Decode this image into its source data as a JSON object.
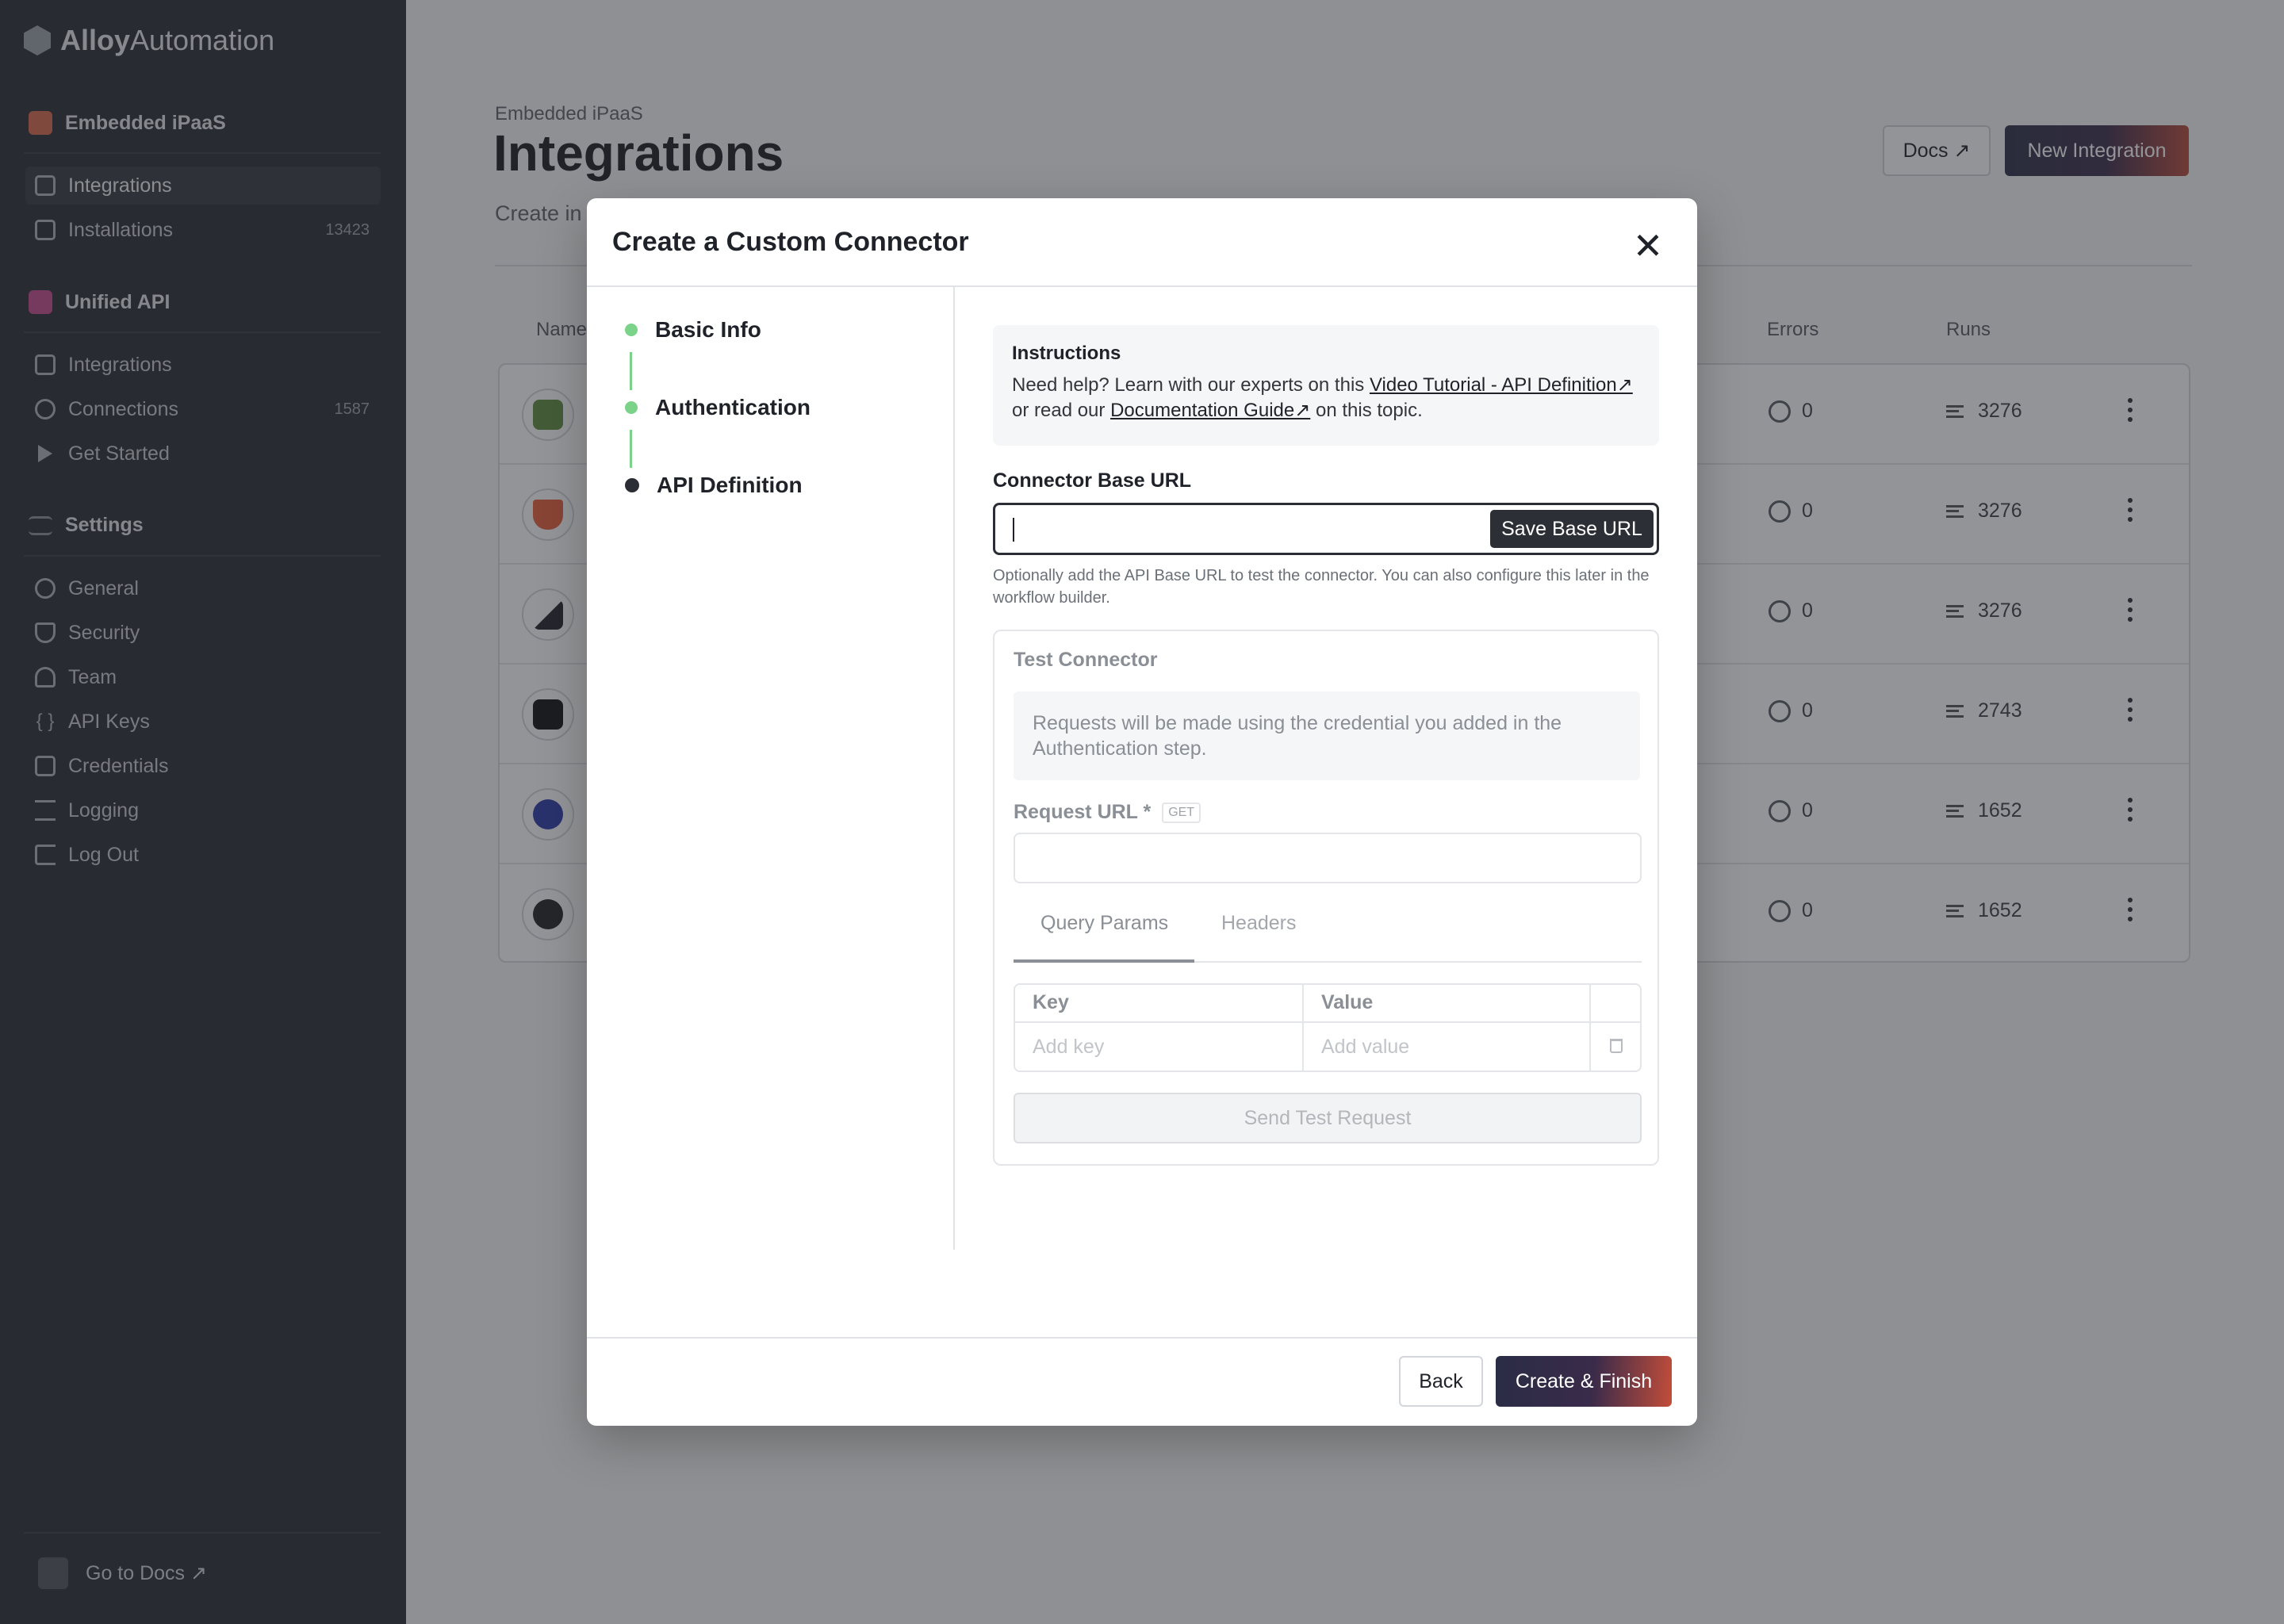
{
  "brand": {
    "name_bold": "Alloy",
    "name_light": "Automation"
  },
  "sidebar": {
    "sections": [
      {
        "title": "Embedded iPaaS",
        "icon": "embedded-ipaas-icon",
        "color": "#d9694a"
      },
      {
        "title": "Unified API",
        "icon": "unified-api-icon",
        "color": "#c24b8b"
      },
      {
        "title": "Settings",
        "icon": "settings-sliders-icon",
        "color": "#8a8f97"
      }
    ],
    "embedded_items": [
      {
        "label": "Integrations",
        "icon": "integrations-icon",
        "active": true
      },
      {
        "label": "Installations",
        "icon": "download-icon",
        "count": "13423"
      }
    ],
    "unified_items": [
      {
        "label": "Integrations",
        "icon": "integrations-icon"
      },
      {
        "label": "Connections",
        "icon": "sync-icon",
        "count": "1587"
      },
      {
        "label": "Get Started",
        "icon": "play-icon"
      }
    ],
    "settings_items": [
      {
        "label": "General",
        "icon": "gear-icon"
      },
      {
        "label": "Security",
        "icon": "shield-icon"
      },
      {
        "label": "Team",
        "icon": "team-icon"
      },
      {
        "label": "API Keys",
        "icon": "braces-icon"
      },
      {
        "label": "Credentials",
        "icon": "credentials-icon"
      },
      {
        "label": "Logging",
        "icon": "logging-icon"
      },
      {
        "label": "Log Out",
        "icon": "logout-icon"
      }
    ],
    "footer_link": "Go to Docs ↗"
  },
  "page": {
    "breadcrumb": "Embedded iPaaS",
    "title": "Integrations",
    "subtitle": "Create in",
    "docs_button": "Docs ↗",
    "new_button": "New Integration",
    "columns": {
      "name": "Name",
      "errors": "Errors",
      "runs": "Runs"
    },
    "rows": [
      {
        "logo": "shopify-logo",
        "color": "#5e8e3e",
        "errors": "0",
        "runs": "3276"
      },
      {
        "logo": "magento-logo",
        "color": "#e85f3a",
        "errors": "0",
        "runs": "3276"
      },
      {
        "logo": "bigcommerce-logo",
        "color": "#22232a",
        "errors": "0",
        "runs": "3276"
      },
      {
        "logo": "notion-logo",
        "color": "#111111",
        "errors": "0",
        "runs": "2743"
      },
      {
        "logo": "yotpo-logo",
        "color": "#2a3aa8",
        "errors": "0",
        "runs": "1652"
      },
      {
        "logo": "mailchimp-logo",
        "color": "#222222",
        "errors": "0",
        "runs": "1652"
      }
    ]
  },
  "modal": {
    "title": "Create a Custom Connector",
    "close": "✕",
    "steps": [
      {
        "label": "Basic Info",
        "status": "done"
      },
      {
        "label": "Authentication",
        "status": "done"
      },
      {
        "label": "API Definition",
        "status": "current"
      }
    ],
    "instructions": {
      "title": "Instructions",
      "text_before": "Need help? Learn with our experts on this ",
      "link1": "Video Tutorial - API Definition↗",
      "text_middle": " or read our ",
      "link2": "Documentation Guide↗",
      "text_after": " on this topic."
    },
    "base_url": {
      "label": "Connector Base URL",
      "value": "",
      "save_button": "Save Base URL",
      "hint": "Optionally add the API Base URL to test the connector. You can also configure this later in the workflow builder."
    },
    "test": {
      "title": "Test Connector",
      "note": "Requests will be made using the credential you added in the Authentication step.",
      "request_label": "Request URL *",
      "method_badge": "GET",
      "tabs": [
        "Query Params",
        "Headers"
      ],
      "active_tab": "Query Params",
      "key_header": "Key",
      "value_header": "Value",
      "key_placeholder": "Add key",
      "value_placeholder": "Add value",
      "send_button": "Send Test Request"
    },
    "back_button": "Back",
    "finish_button": "Create & Finish"
  }
}
